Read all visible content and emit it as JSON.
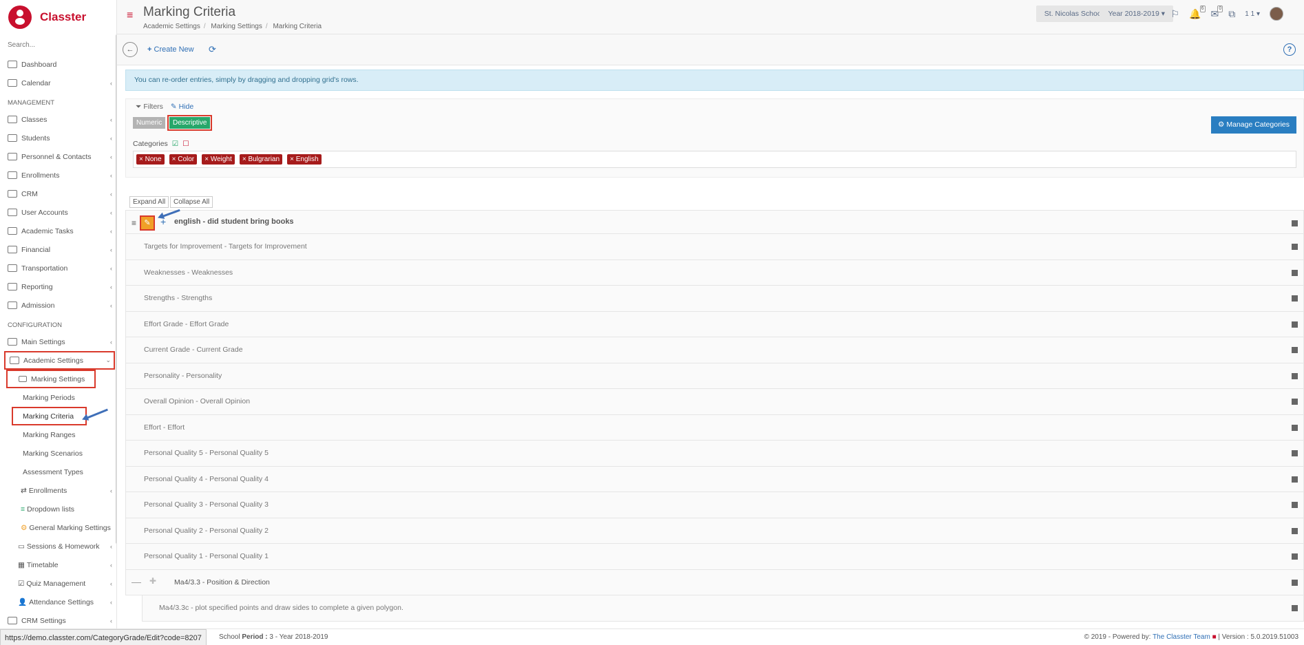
{
  "app": {
    "logo_text": "Classter"
  },
  "sidebar": {
    "search_placeholder": "Search...",
    "items_top": [
      {
        "label": "Dashboard",
        "icon": "laptop-icon"
      },
      {
        "label": "Calendar",
        "icon": "calendar-icon"
      }
    ],
    "management_heading": "MANAGEMENT",
    "management": [
      {
        "label": "Classes"
      },
      {
        "label": "Students"
      },
      {
        "label": "Personnel & Contacts"
      },
      {
        "label": "Enrollments"
      },
      {
        "label": "CRM"
      },
      {
        "label": "User Accounts"
      },
      {
        "label": "Academic Tasks"
      },
      {
        "label": "Financial"
      },
      {
        "label": "Transportation"
      },
      {
        "label": "Reporting"
      },
      {
        "label": "Admission"
      }
    ],
    "configuration_heading": "CONFIGURATION",
    "main_settings": "Main Settings",
    "academic_settings": "Academic Settings",
    "marking_settings": "Marking Settings",
    "marking_sub": [
      "Marking Periods",
      "Marking Criteria",
      "Marking Ranges",
      "Marking Scenarios",
      "Assessment Types"
    ],
    "enrollments": "Enrollments",
    "dropdown_lists": "Dropdown lists",
    "general_marking": "General Marking Settings",
    "sessions": "Sessions & Homework",
    "timetable": "Timetable",
    "quiz": "Quiz Management",
    "attendance": "Attendance Settings",
    "crm_settings": "CRM Settings"
  },
  "header": {
    "title": "Marking Criteria",
    "breadcrumbs": [
      "Academic Settings",
      "Marking Settings",
      "Marking Criteria"
    ],
    "school": "St. Nicolas School",
    "year": "Year 2018-2019",
    "notif_count": "6",
    "mail_count": "0",
    "user_short": "1 1"
  },
  "toolbar": {
    "create_new": "Create New",
    "help": "?"
  },
  "info_message": "You can re-order entries, simply by dragging and dropping grid's rows.",
  "filters": {
    "label": "Filters",
    "hide": "Hide",
    "numeric": "Numeric",
    "descriptive": "Descriptive",
    "categories_label": "Categories",
    "categories": [
      "None",
      "Color",
      "Weight",
      "Bulgrarian",
      "English"
    ],
    "manage_categories": "Manage Categories"
  },
  "grid": {
    "expand_all": "Expand All",
    "collapse_all": "Collapse All",
    "parent": "english - did student bring books",
    "rows": [
      "Targets for Improvement - Targets for Improvement",
      "Weaknesses - Weaknesses",
      "Strengths - Strengths",
      "Effort Grade - Effort Grade",
      "Current Grade - Current Grade",
      "Personality - Personality",
      "Overall Opinion - Overall Opinion",
      "Effort - Effort",
      "Personal Quality 5 - Personal Quality 5",
      "Personal Quality 4 - Personal Quality 4",
      "Personal Quality 3 - Personal Quality 3",
      "Personal Quality 2 - Personal Quality 2",
      "Personal Quality 1 - Personal Quality 1"
    ],
    "ma_parent": "Ma4/3.3 - Position & Direction",
    "ma_child": "Ma4/3.3c - plot specified points and draw sides to complete a given polygon."
  },
  "footer": {
    "status_url": "https://demo.classter.com/CategoryGrade/Edit?code=8207",
    "left_prefix": "School",
    "period_label": "Period :",
    "period_value": "3 - Year 2018-2019",
    "copyright": "2019 - Powered by:",
    "team": "The Classter Team",
    "version": "| Version : 5.0.2019.51003"
  },
  "colors": {
    "brand": "#c8102e",
    "link": "#2f6fb5",
    "descriptive": "#27a76a",
    "tag": "#a61b1b"
  }
}
